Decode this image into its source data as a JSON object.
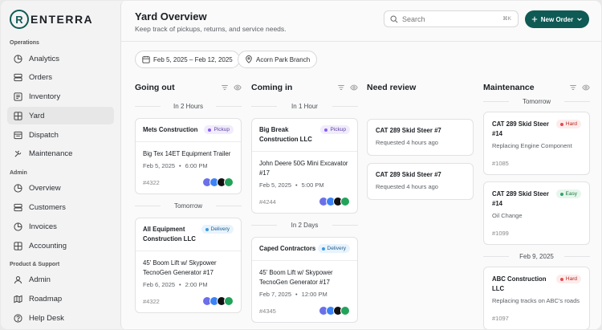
{
  "brand": {
    "logo_letter": "R",
    "name": "ENTERRA"
  },
  "sidebar": {
    "sections": [
      {
        "title": "Operations",
        "items": [
          {
            "label": "Analytics",
            "icon": "analytics-icon"
          },
          {
            "label": "Orders",
            "icon": "orders-icon"
          },
          {
            "label": "Inventory",
            "icon": "inventory-icon"
          },
          {
            "label": "Yard",
            "icon": "yard-icon",
            "active": true
          },
          {
            "label": "Dispatch",
            "icon": "dispatch-icon"
          },
          {
            "label": "Maintenance",
            "icon": "maintenance-icon"
          }
        ]
      },
      {
        "title": "Admin",
        "items": [
          {
            "label": "Overview",
            "icon": "overview-icon"
          },
          {
            "label": "Customers",
            "icon": "customers-icon"
          },
          {
            "label": "Invoices",
            "icon": "invoices-icon"
          },
          {
            "label": "Accounting",
            "icon": "accounting-icon"
          }
        ]
      },
      {
        "title": "Product & Support",
        "items": [
          {
            "label": "Admin",
            "icon": "admin-user-icon"
          },
          {
            "label": "Roadmap",
            "icon": "roadmap-icon"
          },
          {
            "label": "Help Desk",
            "icon": "help-icon"
          }
        ]
      }
    ]
  },
  "header": {
    "title": "Yard Overview",
    "subtitle": "Keep track of pickups, returns, and service needs.",
    "search_placeholder": "Search",
    "search_shortcut": "⌘K",
    "new_order_label": "New Order"
  },
  "filters": {
    "date_range": "Feb 5, 2025 – Feb 12, 2025",
    "branch": "Acorn Park Branch"
  },
  "columns": {
    "going_out": {
      "title": "Going out",
      "groups": [
        {
          "label": "In 2 Hours",
          "cards": [
            {
              "customer": "Mets Construction",
              "badge": "Pickup",
              "equipment": "Big Tex 14ET Equipment Trailer",
              "date": "Feb 5, 2025",
              "time": "6:00 PM",
              "number": "#4322"
            }
          ]
        },
        {
          "label": "Tomorrow",
          "cards": [
            {
              "customer": "All Equipment Construction LLC",
              "badge": "Delivery",
              "equipment": "45' Boom Lift w/ Skypower TecnoGen Generator #17",
              "date": "Feb 6, 2025",
              "time": "2:00 PM",
              "number": "#4322"
            }
          ]
        }
      ]
    },
    "coming_in": {
      "title": "Coming in",
      "groups": [
        {
          "label": "In 1 Hour",
          "cards": [
            {
              "customer": "Big Break Construction LLC",
              "badge": "Pickup",
              "equipment": "John Deere 50G Mini Excavator #17",
              "date": "Feb 5, 2025",
              "time": "5:00 PM",
              "number": "#4244"
            }
          ]
        },
        {
          "label": "In 2 Days",
          "cards": [
            {
              "customer": "Caped Contractors",
              "badge": "Delivery",
              "equipment": "45' Boom Lift w/ Skypower TecnoGen Generator #17",
              "date": "Feb 7, 2025",
              "time": "12:00 PM",
              "number": "#4345"
            }
          ]
        }
      ]
    },
    "need_review": {
      "title": "Need review",
      "cards": [
        {
          "title": "CAT 289 Skid Steer #7",
          "sub": "Requested 4 hours ago"
        },
        {
          "title": "CAT 289 Skid Steer #7",
          "sub": "Requested 4 hours ago"
        }
      ]
    },
    "maintenance": {
      "title": "Maintenance",
      "groups": [
        {
          "label": "Tomorrow",
          "cards": [
            {
              "title": "CAT 289 Skid Steer #14",
              "badge": "Hard",
              "sub": "Replacing Engine Component",
              "number": "#1085"
            },
            {
              "title": "CAT 289 Skid Steer #14",
              "badge": "Easy",
              "sub": "Oil Change",
              "number": "#1099"
            }
          ]
        },
        {
          "label": "Feb 9, 2025",
          "cards": [
            {
              "title": "ABC Construction LLC",
              "badge": "Hard",
              "sub": "Replacing tracks on ABC's roads",
              "number": "#1097"
            }
          ]
        }
      ]
    }
  },
  "colors": {
    "brand": "#0f5a55",
    "avatar_1": "#6b6fe8",
    "avatar_2": "#3b82f6",
    "avatar_3": "#111111",
    "avatar_4": "#22a35a"
  }
}
